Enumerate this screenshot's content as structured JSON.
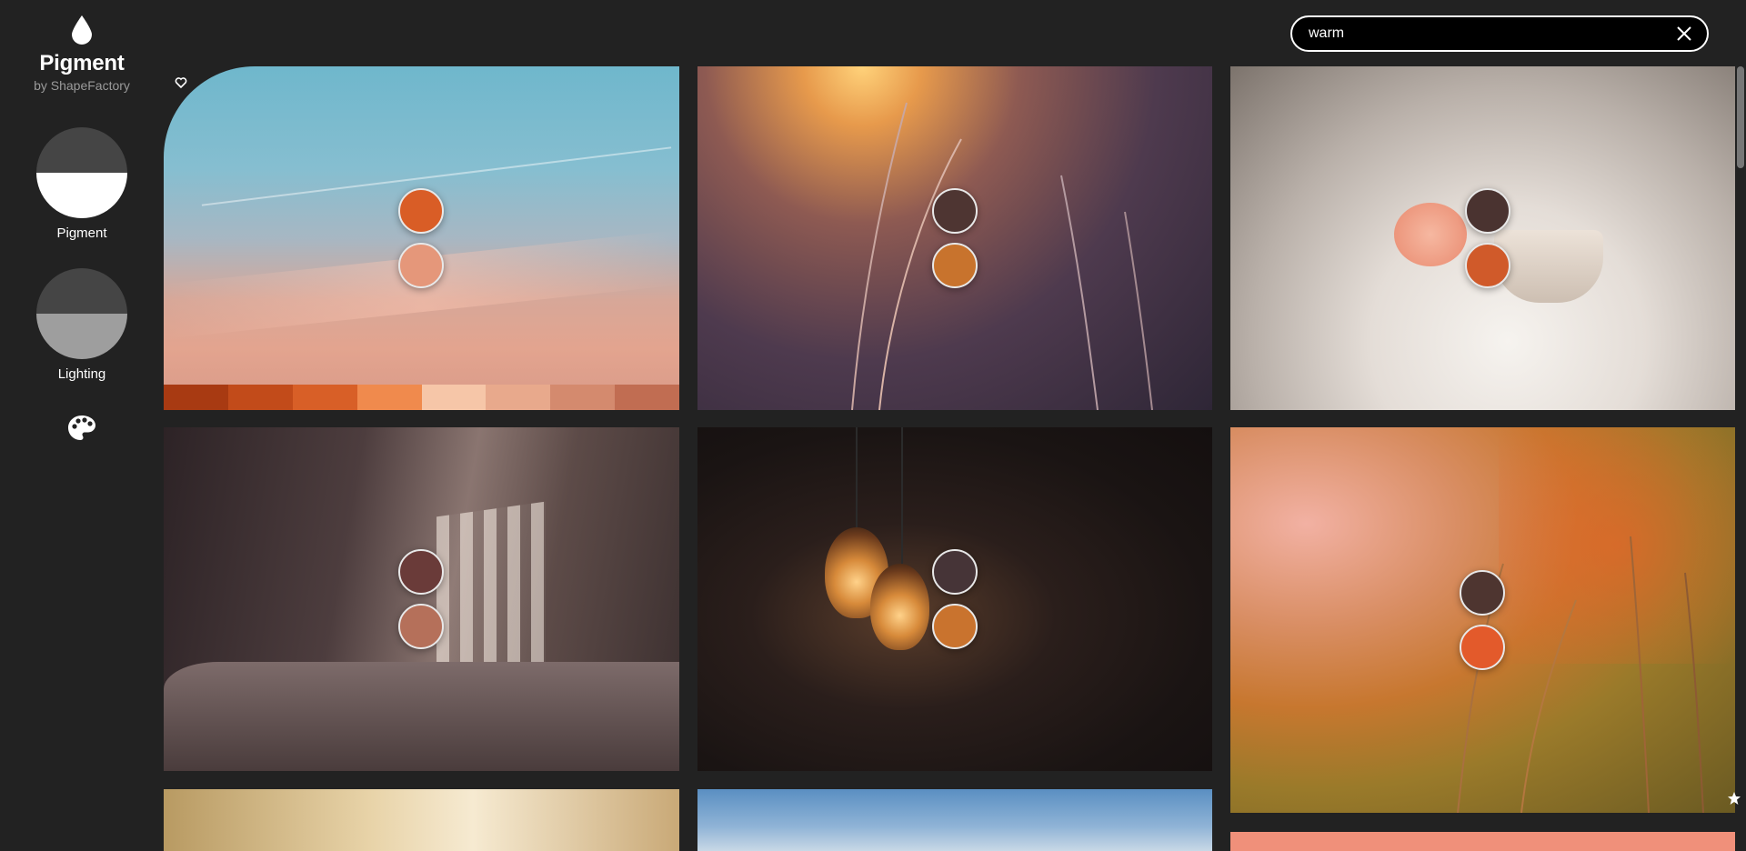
{
  "app": {
    "name": "Pigment",
    "byline": "by ShapeFactory"
  },
  "modes": [
    {
      "label": "Pigment"
    },
    {
      "label": "Lighting"
    }
  ],
  "search": {
    "value": "warm",
    "placeholder": ""
  },
  "icons": {
    "logo": "drop-icon",
    "palette": "palette-icon",
    "clear": "close-icon",
    "favorite": "heart-icon",
    "pin": "star-icon"
  },
  "cards": [
    {
      "swatches": [
        "#d95d26",
        "#e5977a"
      ],
      "strip": [
        "#a83a12",
        "#c24b1a",
        "#d85f27",
        "#f08a4d",
        "#f6c6a8",
        "#e8a98c",
        "#d48a6e",
        "#c16d52"
      ]
    },
    {
      "swatches": [
        "#4e3532",
        "#c8732d"
      ]
    },
    {
      "swatches": [
        "#4a3330",
        "#d05a2a"
      ]
    },
    {
      "swatches": [
        "#6a3b39",
        "#b5705a"
      ]
    },
    {
      "swatches": [
        "#463437",
        "#c9732e"
      ]
    },
    {
      "swatches": [
        "#4e3530",
        "#e35a2b"
      ]
    }
  ]
}
